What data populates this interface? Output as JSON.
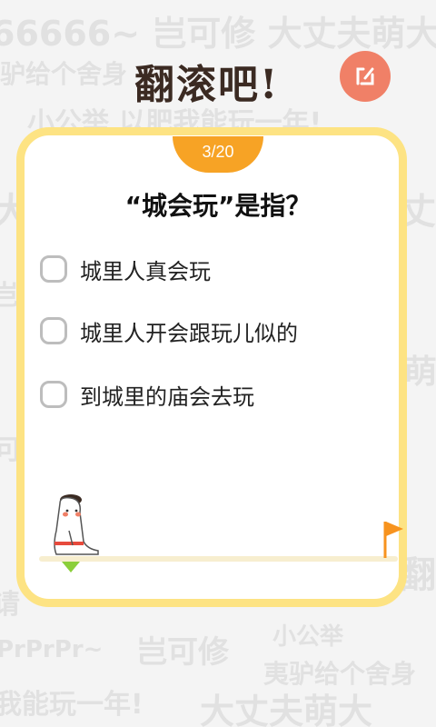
{
  "header": {
    "logo_text": "翻滚吧!",
    "share_icon": "share-icon"
  },
  "progress": {
    "current": 3,
    "total": 20,
    "label": "3/20"
  },
  "question": {
    "text": "“城会玩”是指？"
  },
  "options": [
    {
      "label": "城里人真会玩"
    },
    {
      "label": "城里人开会跟玩儿似的"
    },
    {
      "label": "到城里的庙会去玩"
    }
  ],
  "colors": {
    "card_border": "#fde383",
    "progress_tab": "#f7a325",
    "share_button": "#f08067",
    "flag": "#f7931e",
    "marker": "#8bcf3a"
  }
}
